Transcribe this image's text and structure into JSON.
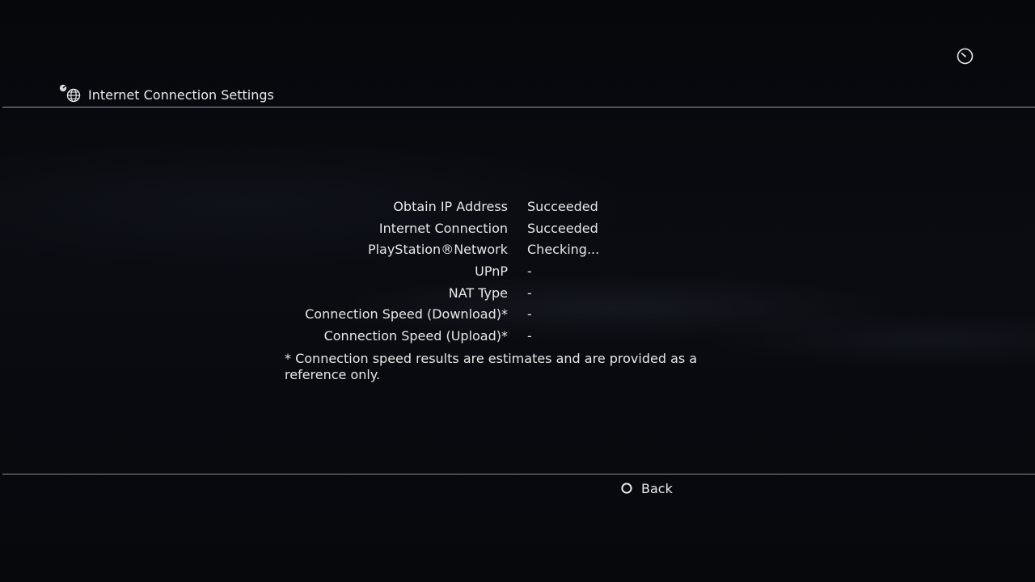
{
  "header": {
    "title": "Internet Connection Settings",
    "icon": "network-settings-icon"
  },
  "status_icon": "clock-icon",
  "results": [
    {
      "label": "Obtain IP Address",
      "value": "Succeeded"
    },
    {
      "label": "Internet Connection",
      "value": "Succeeded"
    },
    {
      "label": "PlayStation®Network",
      "value": "Checking..."
    },
    {
      "label": "UPnP",
      "value": "-"
    },
    {
      "label": "NAT Type",
      "value": "-"
    },
    {
      "label": "Connection Speed (Download)*",
      "value": "-"
    },
    {
      "label": "Connection Speed (Upload)*",
      "value": "-"
    }
  ],
  "footnote": "* Connection speed results are estimates and are provided as a reference only.",
  "footer": {
    "back_label": "Back",
    "back_button_icon": "circle-button-icon"
  },
  "colors": {
    "background": "#07080c",
    "text": "#e8e8e8",
    "rule": "#9a9ca2"
  }
}
